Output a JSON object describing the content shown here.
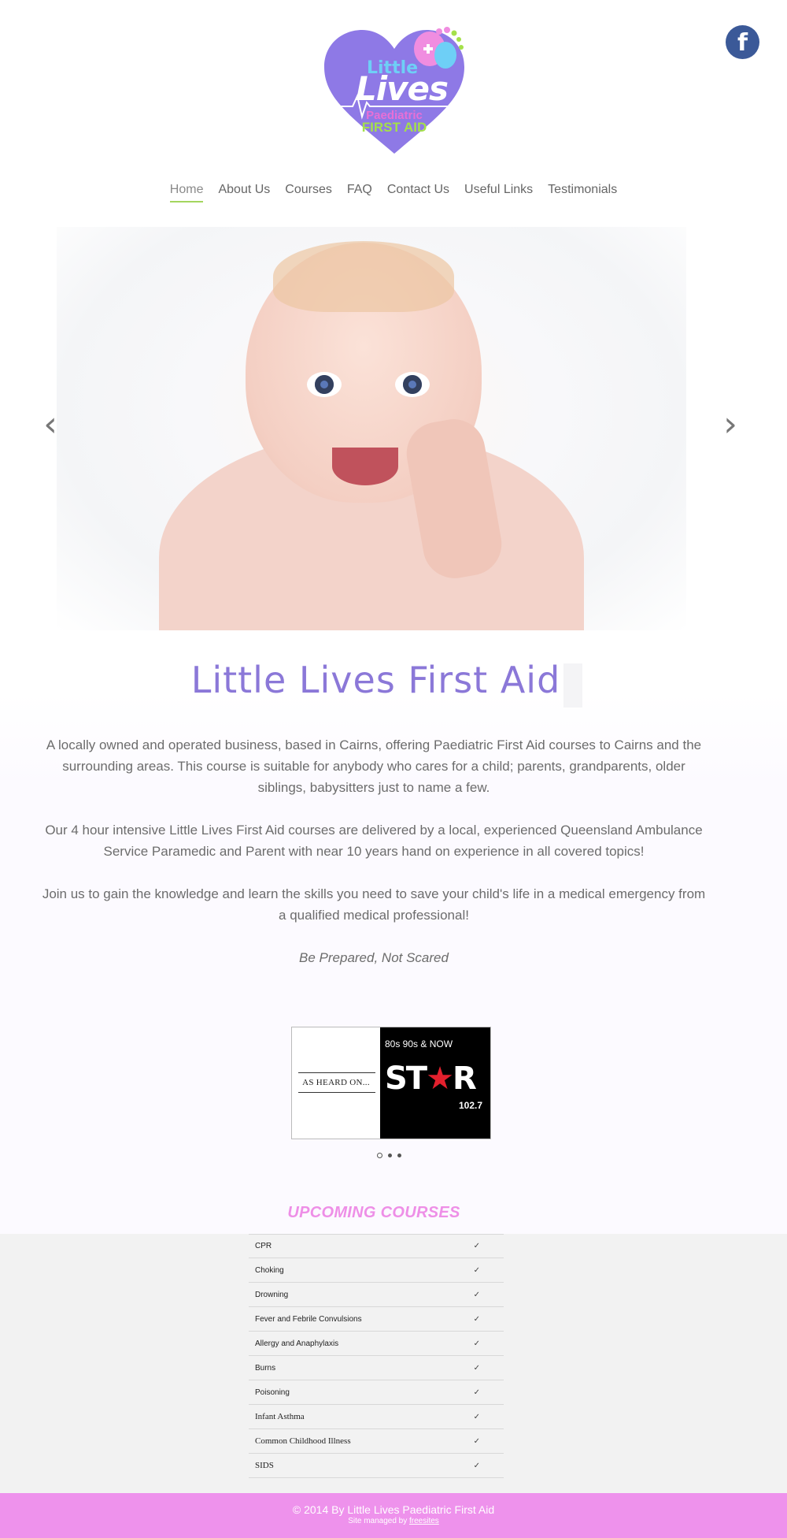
{
  "social": {
    "facebook_icon": "facebook-icon",
    "facebook_glyph": "f"
  },
  "logo": {
    "little": "Little",
    "lives": "Lives",
    "paediatric": "Paediatric",
    "first_aid": "FIRST AID"
  },
  "nav": {
    "items": [
      {
        "label": "Home",
        "active": true
      },
      {
        "label": "About Us"
      },
      {
        "label": "Courses"
      },
      {
        "label": "FAQ"
      },
      {
        "label": "Contact Us"
      },
      {
        "label": "Useful Links"
      },
      {
        "label": "Testimonials"
      }
    ]
  },
  "slider": {
    "prev_icon": "chevron-left-icon",
    "next_icon": "chevron-right-icon",
    "prev_glyph": "‹",
    "next_glyph": "›"
  },
  "main": {
    "title": "Little Lives First Aid",
    "paragraphs": [
      "A locally owned and operated business, based in Cairns, offering Paediatric First Aid courses to Cairns and the surrounding areas. This course is suitable for anybody who cares for a child; parents, grandparents, older siblings, babysitters just to name a few.",
      "Our 4 hour intensive Little Lives First Aid courses are delivered by a local, experienced Queensland Ambulance Service Paramedic and Parent with near 10 years hand on experience in all covered topics!",
      "Join us to gain the knowledge and learn the skills you need to save your child's life in a medical emergency from a qualified medical professional!"
    ],
    "motto": "Be Prepared, Not Scared"
  },
  "badge": {
    "heard_on": "AS HEARD ON...",
    "era": "80s 90s & NOW",
    "station_left": "ST",
    "station_star": "★",
    "station_right": "R",
    "frequency": "102.7"
  },
  "upcoming": {
    "title": "UPCOMING COURSES",
    "check": "✓",
    "courses": [
      "CPR",
      "Choking",
      "Drowning",
      "Fever and Febrile Convulsions",
      "Allergy and Anaphylaxis",
      "Burns",
      "Poisoning",
      "Infant Asthma",
      "Common Childhood Illness",
      "SIDS"
    ]
  },
  "footer": {
    "copyright": "© 2014 By Little Lives Paediatric First Aid",
    "managed_prefix": "Site managed by ",
    "managed_link": "freesites"
  },
  "colors": {
    "accent_purple": "#8b78d8",
    "accent_pink": "#ee92ec",
    "active_underline": "#a4d65e",
    "facebook_blue": "#3b5998"
  }
}
